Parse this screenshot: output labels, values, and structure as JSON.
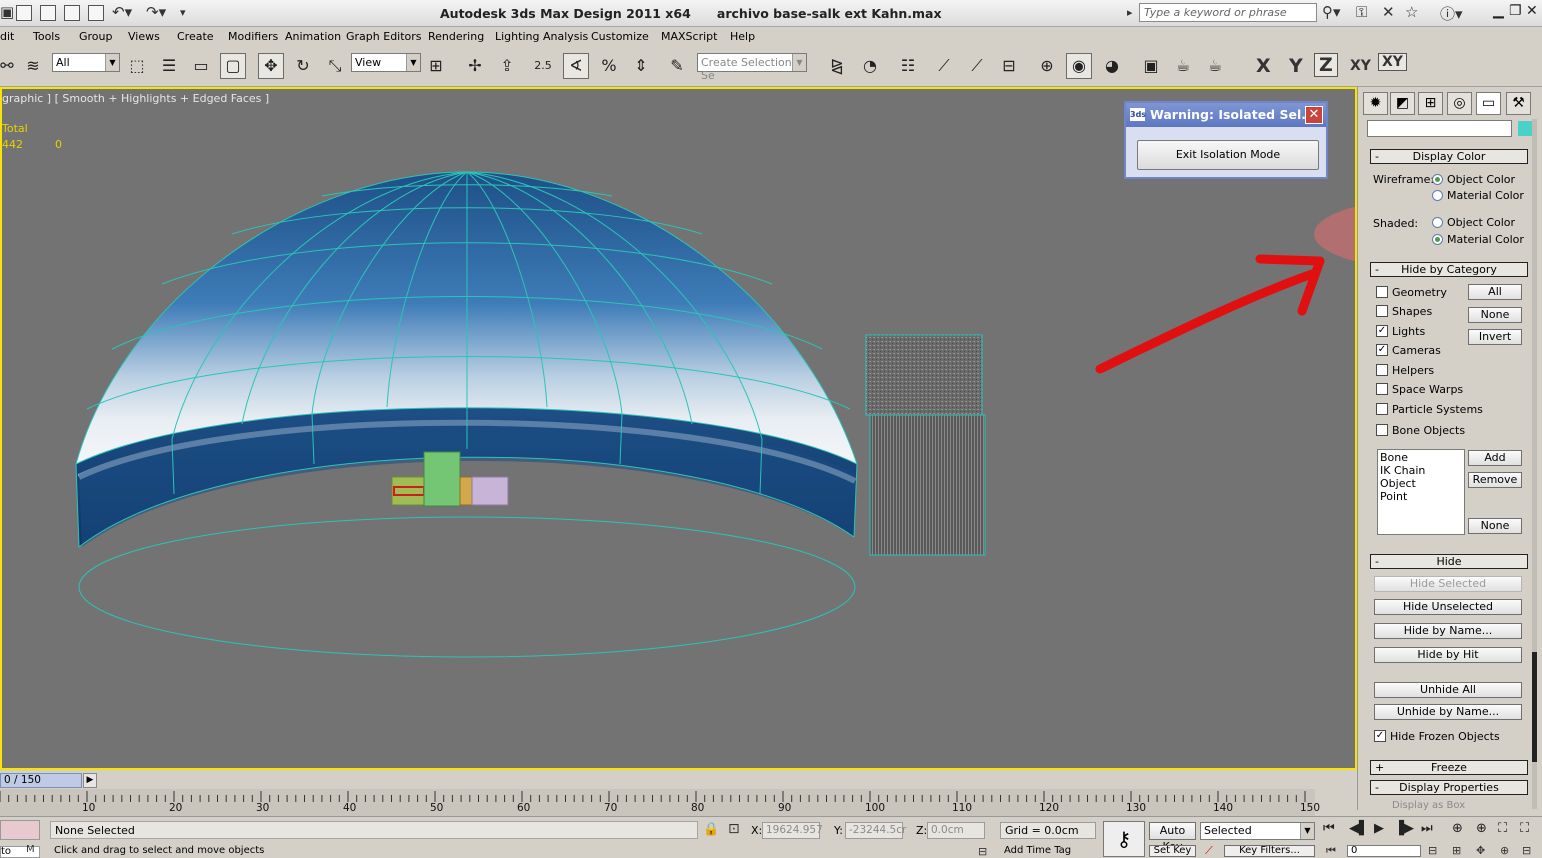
{
  "window": {
    "app_title": "Autodesk 3ds Max Design 2011 x64",
    "file_name": "archivo base-salk ext Kahn.max",
    "search_placeholder": "Type a keyword or phrase"
  },
  "menu": [
    "dit",
    "Tools",
    "Group",
    "Views",
    "Create",
    "Modifiers",
    "Animation",
    "Graph Editors",
    "Rendering",
    "Lighting Analysis",
    "Customize",
    "MAXScript",
    "Help"
  ],
  "toolbar": {
    "filter_value": "All",
    "refcoord_value": "View",
    "snap_value": "2.5",
    "named_selection_placeholder": "Create Selection Se",
    "axis_x": "X",
    "axis_y": "Y",
    "axis_z": "Z",
    "axis_xy": "XY",
    "axis_xy2": "XY"
  },
  "viewport": {
    "label": "graphic ] [ Smooth + Highlights + Edged Faces ]",
    "stats_total": "Total",
    "stats_count": "442",
    "stats_zero": "0",
    "colors": {
      "background": "#737373",
      "border": "#f7e400",
      "wire": "#2bc4b8",
      "annotation": "#e01010"
    }
  },
  "warning_dialog": {
    "title": "Warning: Isolated Sel...",
    "button": "Exit Isolation Mode"
  },
  "command_panel": {
    "display_color": {
      "header": "Display Color",
      "wireframe_label": "Wireframe:",
      "wireframe_options": [
        "Object Color",
        "Material Color"
      ],
      "wireframe_selected": "Object Color",
      "shaded_label": "Shaded:",
      "shaded_options": [
        "Object Color",
        "Material Color"
      ],
      "shaded_selected": "Material Color"
    },
    "hide_by_category": {
      "header": "Hide by Category",
      "categories": [
        {
          "label": "Geometry",
          "checked": false
        },
        {
          "label": "Shapes",
          "checked": false
        },
        {
          "label": "Lights",
          "checked": true
        },
        {
          "label": "Cameras",
          "checked": true
        },
        {
          "label": "Helpers",
          "checked": false
        },
        {
          "label": "Space Warps",
          "checked": false
        },
        {
          "label": "Particle Systems",
          "checked": false
        },
        {
          "label": "Bone Objects",
          "checked": false
        }
      ],
      "btn_all": "All",
      "btn_none": "None",
      "btn_invert": "Invert",
      "list_items": [
        "Bone",
        "IK Chain Object",
        "Point"
      ],
      "btn_add": "Add",
      "btn_remove": "Remove",
      "btn_none2": "None"
    },
    "hide": {
      "header": "Hide",
      "hide_selected": "Hide Selected",
      "hide_unselected": "Hide Unselected",
      "hide_by_name": "Hide by Name...",
      "hide_by_hit": "Hide by Hit",
      "unhide_all": "Unhide All",
      "unhide_by_name": "Unhide by Name...",
      "hide_frozen": "Hide Frozen Objects",
      "hide_frozen_checked": true
    },
    "freeze_header": "Freeze",
    "display_properties_header": "Display Properties",
    "display_as_box": "Display as Box"
  },
  "timeline": {
    "frame_readout": "0 / 150",
    "ticks": [
      "10",
      "20",
      "30",
      "40",
      "50",
      "60",
      "70",
      "80",
      "90",
      "100",
      "110",
      "120",
      "130",
      "140",
      "150"
    ]
  },
  "status": {
    "selection": "None Selected",
    "prompt": "Click and drag to select and move objects",
    "x_label": "X:",
    "x_value": "19624.957",
    "y_label": "Y:",
    "y_value": "-23244.5cr",
    "z_label": "Z:",
    "z_value": "0.0cm",
    "grid": "Grid = 0.0cm",
    "add_time_tag": "Add Time Tag",
    "auto_key": "Auto Key",
    "set_key": "Set Key",
    "key_mode": "Selected",
    "key_filters": "Key Filters...",
    "frame_input": "0",
    "maxscript_text": "to"
  }
}
